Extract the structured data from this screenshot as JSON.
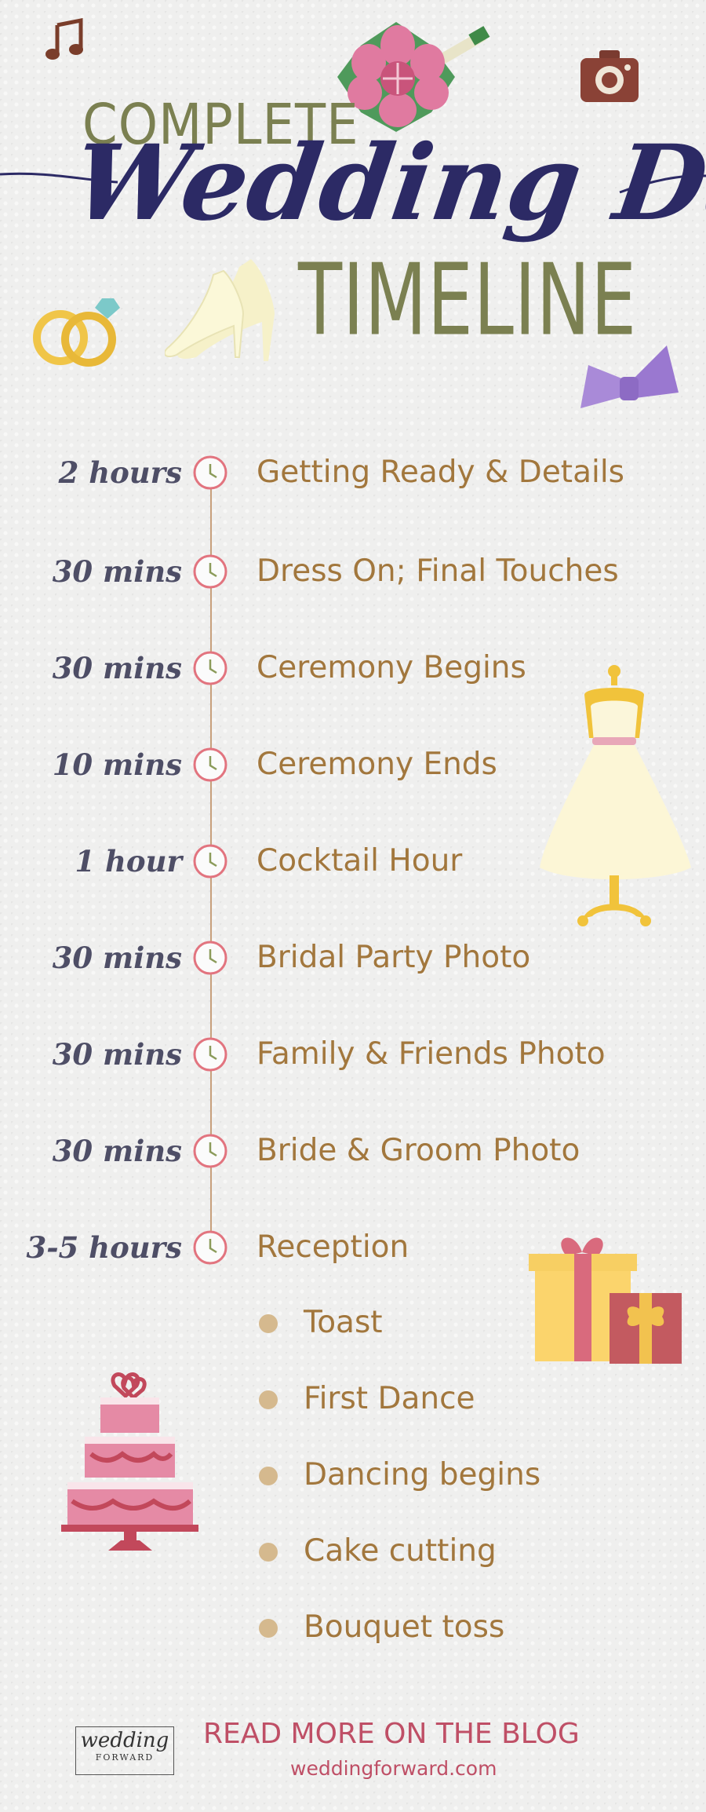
{
  "header": {
    "line1": "COMPLETE",
    "line2": "Wedding Day",
    "line3": "TIMELINE"
  },
  "timeline": [
    {
      "duration": "2 hours",
      "event": "Getting Ready & Details"
    },
    {
      "duration": "30 mins",
      "event": "Dress On; Final Touches"
    },
    {
      "duration": "30 mins",
      "event": "Ceremony Begins"
    },
    {
      "duration": "10 mins",
      "event": "Ceremony Ends"
    },
    {
      "duration": "1 hour",
      "event": "Cocktail Hour"
    },
    {
      "duration": "30 mins",
      "event": "Bridal Party Photo"
    },
    {
      "duration": "30 mins",
      "event": "Family & Friends Photo"
    },
    {
      "duration": "30 mins",
      "event": "Bride & Groom Photo"
    },
    {
      "duration": "3-5 hours",
      "event": "Reception"
    }
  ],
  "reception_items": [
    "Toast",
    "First Dance",
    "Dancing begins",
    "Cake cutting",
    "Bouquet toss"
  ],
  "footer": {
    "logo_word": "wedding",
    "logo_sub": "FORWARD",
    "cta": "READ MORE ON THE BLOG",
    "url": "weddingforward.com"
  },
  "colors": {
    "background": "#efefee",
    "title_olive": "#7b8051",
    "title_navy": "#2c2a65",
    "duration": "#4e4e66",
    "event": "#a2773d",
    "clock_ring": "#e2747f",
    "cta": "#bf4f66"
  },
  "icons": [
    "music-note-icon",
    "bouquet-icon",
    "camera-icon",
    "rings-icon",
    "shoes-icon",
    "bow-tie-icon",
    "dress-icon",
    "gift-icon",
    "cake-icon",
    "clock-icon"
  ]
}
